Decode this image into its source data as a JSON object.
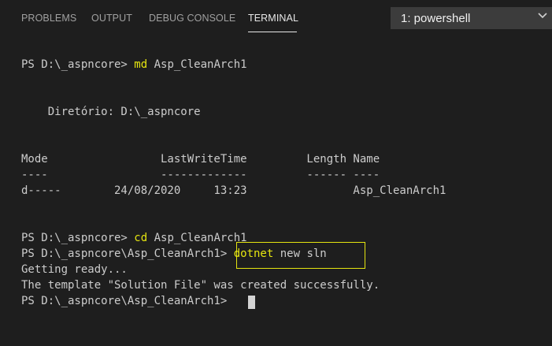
{
  "tabs": {
    "problems": "PROBLEMS",
    "output": "OUTPUT",
    "debug_console": "DEBUG CONSOLE",
    "terminal": "TERMINAL"
  },
  "terminal_select": {
    "selected": "1: powershell"
  },
  "lines": {
    "l1_prompt": "PS D:\\_aspncore> ",
    "l1_cmd": "md",
    "l1_args": " Asp_CleanArch1",
    "l2": "    Diretório: D:\\_aspncore",
    "l3": "Mode                 LastWriteTime         Length Name",
    "l4": "----                 -------------         ------ ----",
    "l5": "d-----        24/08/2020     13:23                Asp_CleanArch1",
    "l6_prompt": "PS D:\\_aspncore> ",
    "l6_cmd": "cd",
    "l6_args": " Asp_CleanArch1",
    "l7_prompt": "PS D:\\_aspncore\\Asp_CleanArch1> ",
    "l7_cmd": "dotnet",
    "l7_args": " new sln",
    "l8": "Getting ready...",
    "l9": "The template \"Solution File\" was created successfully.",
    "l10_prompt": "PS D:\\_aspncore\\Asp_CleanArch1> "
  },
  "colors": {
    "background": "#1e1e1e",
    "command_yellow": "#e5e510",
    "text": "#cccccc"
  },
  "icons": {
    "dropdown": "chevron-down-icon"
  }
}
